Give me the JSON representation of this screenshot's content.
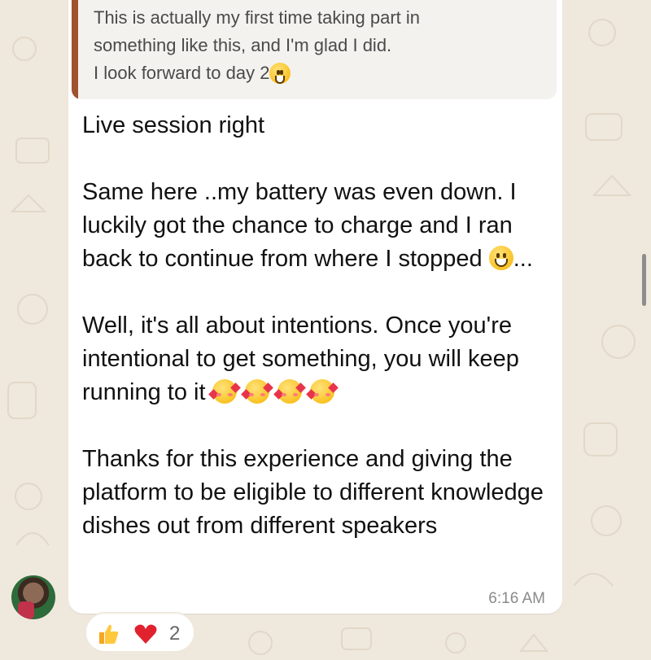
{
  "quoted_message": {
    "text": "This is actually my first time taking part in\nsomething like this, and I'm glad I did.\nI look forward to day 2"
  },
  "message": {
    "paragraph1": "Live session right",
    "paragraph2": "Same here ..my battery was even down. I luckily got the chance to charge and I ran back to continue from where I stopped",
    "paragraph2_suffix": "...",
    "paragraph3": "Well, it's all about intentions. Once you're intentional to get something, you will keep running to it",
    "paragraph4": "Thanks for this experience and giving the platform to be eligible to different knowledge dishes out from different speakers",
    "time": "6:16 AM"
  },
  "reactions": {
    "emojis": [
      "thumbs-up",
      "red-heart"
    ],
    "count": "2"
  },
  "colors": {
    "background": "#efe8dd",
    "bubble": "#ffffff",
    "quote_bar": "#a0522d",
    "timestamp": "#8a8a8a"
  }
}
